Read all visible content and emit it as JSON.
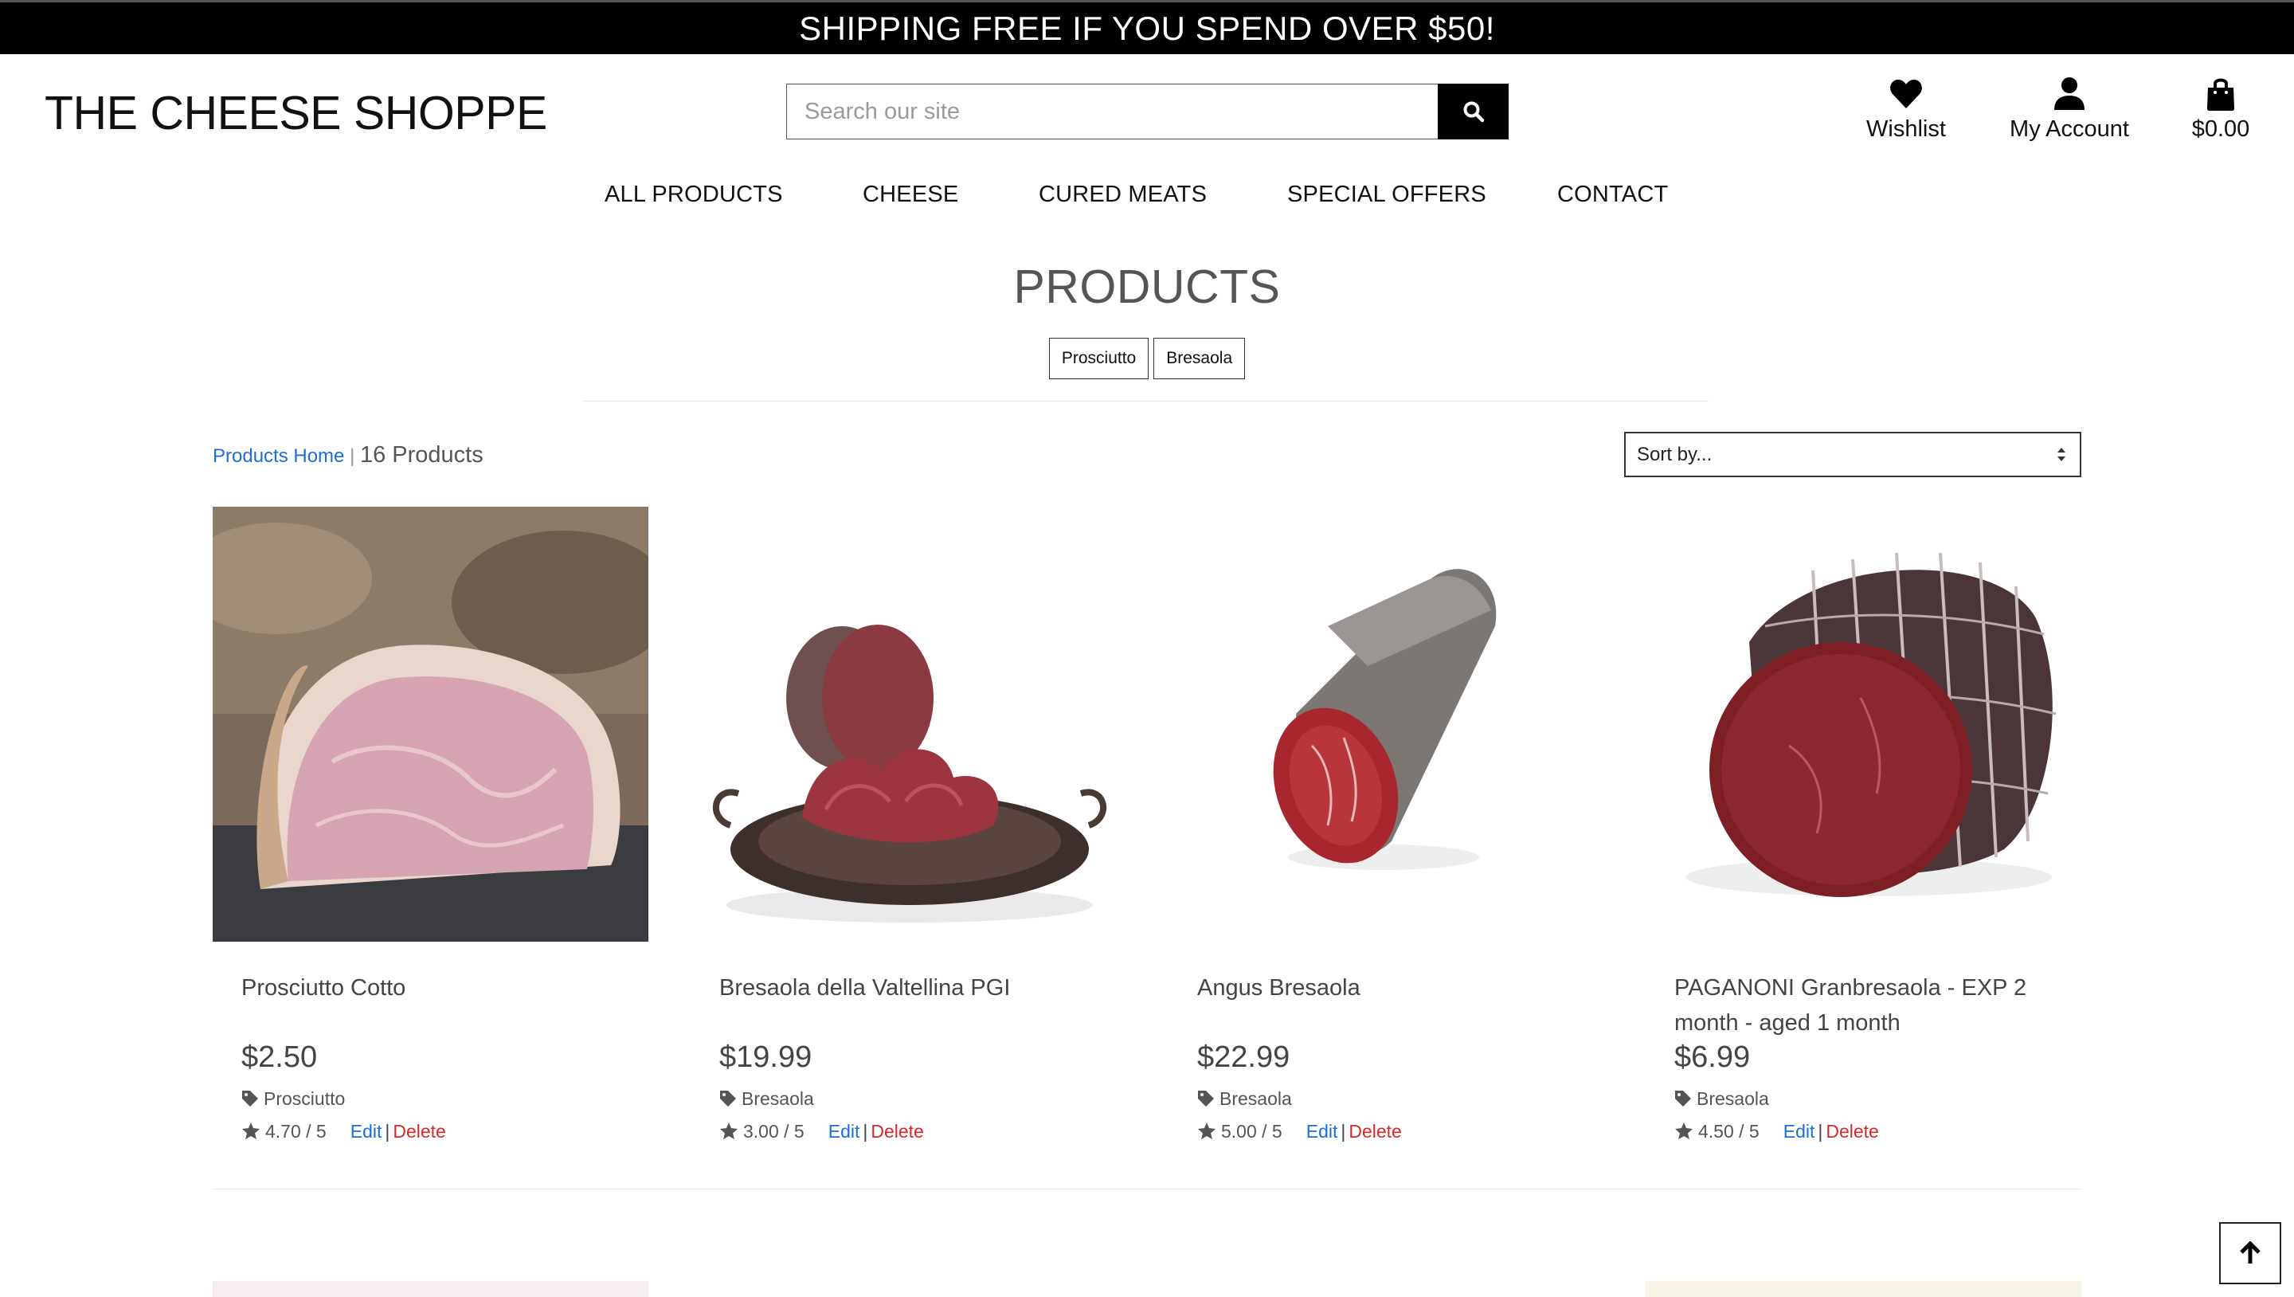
{
  "banner": {
    "text": "SHIPPING FREE IF YOU SPEND OVER $50!"
  },
  "header": {
    "logo": "THE CHEESE SHOPPE",
    "search_placeholder": "Search our site",
    "wishlist_label": "Wishlist",
    "account_label": "My Account",
    "cart_total": "$0.00"
  },
  "nav": {
    "items": [
      "ALL PRODUCTS",
      "CHEESE",
      "CURED MEATS",
      "SPECIAL OFFERS",
      "CONTACT"
    ]
  },
  "main": {
    "title": "PRODUCTS",
    "category_tags": [
      "Prosciutto",
      "Bresaola"
    ],
    "breadcrumb_home": "Products Home",
    "breadcrumb_sep": " | ",
    "product_count": "16 Products",
    "sort_value": "Sort by...",
    "products": [
      {
        "name": "Prosciutto Cotto",
        "price": "$2.50",
        "category": "Prosciutto",
        "rating": "4.70 / 5",
        "edit": "Edit",
        "delete": "Delete"
      },
      {
        "name": "Bresaola della Valtellina PGI",
        "price": "$19.99",
        "category": "Bresaola",
        "rating": "3.00 / 5",
        "edit": "Edit",
        "delete": "Delete"
      },
      {
        "name": "Angus Bresaola",
        "price": "$22.99",
        "category": "Bresaola",
        "rating": "5.00 / 5",
        "edit": "Edit",
        "delete": "Delete"
      },
      {
        "name": "PAGANONI Granbresaola - EXP 2 month - aged 1 month",
        "price": "$6.99",
        "category": "Bresaola",
        "rating": "4.50 / 5",
        "edit": "Edit",
        "delete": "Delete"
      }
    ]
  },
  "icons": {
    "search": "search-icon",
    "wishlist": "heart-icon",
    "account": "user-icon",
    "cart": "shopping-bag-icon",
    "category": "tag-icon",
    "rating": "star-icon",
    "back_to_top": "arrow-up-icon"
  },
  "colors": {
    "banner_bg": "#000000",
    "link_blue": "#1a6fd6",
    "delete_red": "#d62828",
    "text_gray": "#555555"
  }
}
